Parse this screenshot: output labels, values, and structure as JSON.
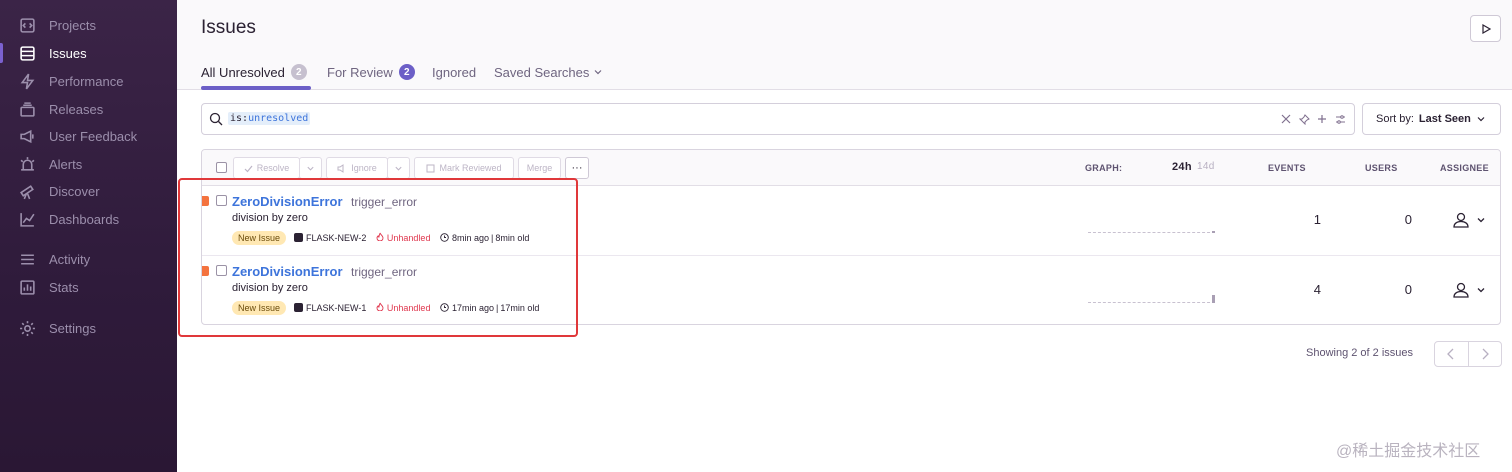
{
  "sidebar": {
    "items": [
      {
        "label": "Projects",
        "icon": "projects-icon"
      },
      {
        "label": "Issues",
        "icon": "issues-icon",
        "active": true
      },
      {
        "label": "Performance",
        "icon": "lightning-icon"
      },
      {
        "label": "Releases",
        "icon": "releases-icon"
      },
      {
        "label": "User Feedback",
        "icon": "megaphone-icon"
      },
      {
        "label": "Alerts",
        "icon": "siren-icon"
      },
      {
        "label": "Discover",
        "icon": "telescope-icon"
      },
      {
        "label": "Dashboards",
        "icon": "graph-icon"
      },
      {
        "label": "Activity",
        "icon": "list-icon"
      },
      {
        "label": "Stats",
        "icon": "stats-icon"
      },
      {
        "label": "Settings",
        "icon": "gear-icon"
      }
    ]
  },
  "header": {
    "title": "Issues",
    "tabs": [
      {
        "label": "All Unresolved",
        "count": "2"
      },
      {
        "label": "For Review",
        "count": "2"
      },
      {
        "label": "Ignored"
      },
      {
        "label": "Saved Searches"
      }
    ]
  },
  "search": {
    "token_key": "is:",
    "token_value": "unresolved"
  },
  "sort": {
    "prefix": "Sort by:",
    "value": "Last Seen"
  },
  "table": {
    "actions": {
      "resolve": "Resolve",
      "ignore": "Ignore",
      "mark_reviewed": "Mark Reviewed",
      "merge": "Merge",
      "more": "···"
    },
    "columns": {
      "graph": "GRAPH:",
      "range_24h": "24h",
      "range_14d": "14d",
      "events": "EVENTS",
      "users": "USERS",
      "assignee": "ASSIGNEE"
    },
    "rows": [
      {
        "title": "ZeroDivisionError",
        "culprit": "trigger_error",
        "message": "division by zero",
        "badge": "New Issue",
        "short_id": "FLASK-NEW-2",
        "handled": "Unhandled",
        "last_seen": "8min ago",
        "age": "8min old",
        "events": "1",
        "users": "0",
        "graph_fraction": 0.1
      },
      {
        "title": "ZeroDivisionError",
        "culprit": "trigger_error",
        "message": "division by zero",
        "badge": "New Issue",
        "short_id": "FLASK-NEW-1",
        "handled": "Unhandled",
        "last_seen": "17min ago",
        "age": "17min old",
        "events": "4",
        "users": "0",
        "graph_fraction": 0.4
      }
    ]
  },
  "footer": {
    "showing": "Showing 2 of 2 issues"
  },
  "watermark": "@稀土掘金技术社区",
  "colors": {
    "accent": "#6c5fc7",
    "link": "#3d74db",
    "error_level": "#f4733f",
    "unhandled": "#e0374e",
    "highlight": "#e0383a"
  }
}
